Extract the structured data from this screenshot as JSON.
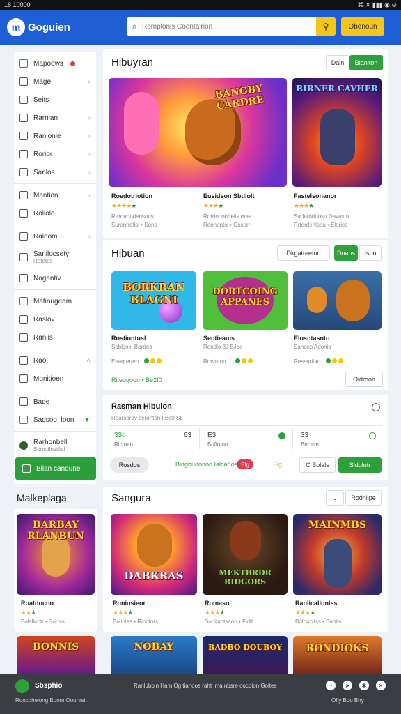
{
  "status": {
    "left": "18 10000",
    "right": "⌘ ✕ ▮▮▮ ◉ ⊙"
  },
  "header": {
    "logo_mark": "m",
    "logo_text": "Goguien",
    "search_placeholder": "Romplonis Coontairion",
    "button_label": "Obenoun"
  },
  "sidebar": {
    "items": [
      {
        "label": "Mapoows"
      },
      {
        "label": "Mage"
      },
      {
        "label": "Seits"
      },
      {
        "label": "Rarnian"
      },
      {
        "label": "Ranlonie"
      },
      {
        "label": "Rorior"
      },
      {
        "label": "Sanlos"
      },
      {
        "label": "Mantion"
      },
      {
        "label": "Roliolo"
      },
      {
        "label": "Rainom"
      },
      {
        "label": "Sanilocsety",
        "sub": "Rotetes"
      },
      {
        "label": "Nogantiv"
      },
      {
        "label": "Matiougeam"
      },
      {
        "label": "Raslov"
      },
      {
        "label": "Ranlis"
      },
      {
        "label": "Rao"
      },
      {
        "label": "Monitioen"
      },
      {
        "label": "Bade"
      },
      {
        "label": "Sadsoo: loon"
      },
      {
        "label": "Rarhonbell",
        "sub": "Sonsdinstitel"
      }
    ],
    "cta": "Bilan canoune"
  },
  "sec1": {
    "title": "Hibuyran",
    "btn_out": "Dain",
    "btn_green": "Bianiton",
    "games": [
      {
        "title": "Roedotriotion",
        "meta1": "Rerdanoderisous",
        "meta2": "Surannetisi • Sons"
      },
      {
        "title": "Eusidson Sbdiolt",
        "meta1": "Rorrionondelis mas",
        "meta2": "Reonentsi • Ossorr"
      },
      {
        "title": "Fastelsonanor",
        "meta1": "Saderoduosu Davasto",
        "meta2": "Rrterdenlsau • Elarice"
      }
    ],
    "art": [
      "BANGBY CARDRE",
      "BIRNER CAVHER"
    ]
  },
  "sec2": {
    "title": "Hibuan",
    "btn_out": "Dkgatreeton",
    "btn_green": "Doans",
    "btn_out2": "Isbn",
    "games": [
      {
        "title": "Rostiontusl",
        "meta1": "Sobkjox. Bordea",
        "meta2": "Eeaqterten"
      },
      {
        "title": "Seotieauis",
        "meta1": "Rondio 3J BJbe",
        "meta2": "Rorvtaon"
      },
      {
        "title": "Elosntasnto",
        "meta1": "Sanoes Adonia",
        "meta2": "Ressroltao"
      }
    ],
    "art": [
      "BORKRAN BLAGNI",
      "DORTCOING APPANES"
    ],
    "footer_left": "Riteogoon • Be2f0",
    "footer_btn": "Oidroon"
  },
  "sec3": {
    "title": "Rasman Hibuion",
    "subtitle": "Rearsordy ceronton I Bc0 Sb",
    "stats": [
      {
        "value": "33d",
        "label": "Rictoan"
      },
      {
        "value": "63",
        "label": "Bofloton"
      },
      {
        "value": "E3",
        "label": "Bolsies"
      },
      {
        "value": "33",
        "label": "Berntm"
      }
    ],
    "pill": "Rosdos",
    "midtext": "Bidgbudonoo Ialcanos",
    "tag": "Sfg",
    "tag2": "Blg",
    "btn_out": "C Bolals",
    "btn_green": "Sidolntr"
  },
  "market": {
    "title": "Malkeplaga",
    "games": [
      {
        "title": "Roatdocoo",
        "meta1": "Bolsllontr • Sornis",
        "art": "BARBAY RLANBUN"
      },
      {
        "title": "Roniosieor",
        "meta1": "Bolintss • Rinotors",
        "art": "DABKRAS"
      },
      {
        "title": "Romaso",
        "meta1": "Sonimotsaon • Fldit",
        "art": "MEKTBRDR BIDGORS"
      },
      {
        "title": "Ranlicalloniss",
        "meta1": "Bolonoitss • Saoits",
        "art": "MAINMBS"
      }
    ]
  },
  "sec4": {
    "title": "Sangura",
    "btn_out": "Rodnlipe",
    "art": [
      "BONNIS",
      "NOBAY",
      "BADBO DOUBOY",
      "RONDIOKS"
    ]
  },
  "footer": {
    "brand": "Sbsphio",
    "sub": "Roocoheiong Boom Oounrsit",
    "center": "Ranlubbin Ham Og tianoos raht Ima nbsre oocoion Goites",
    "links": "Ofiy Boo Bhy"
  },
  "colors": {
    "primary": "#1f5fd6",
    "accent_green": "#2ea03b",
    "accent_yellow": "#f5c518"
  }
}
